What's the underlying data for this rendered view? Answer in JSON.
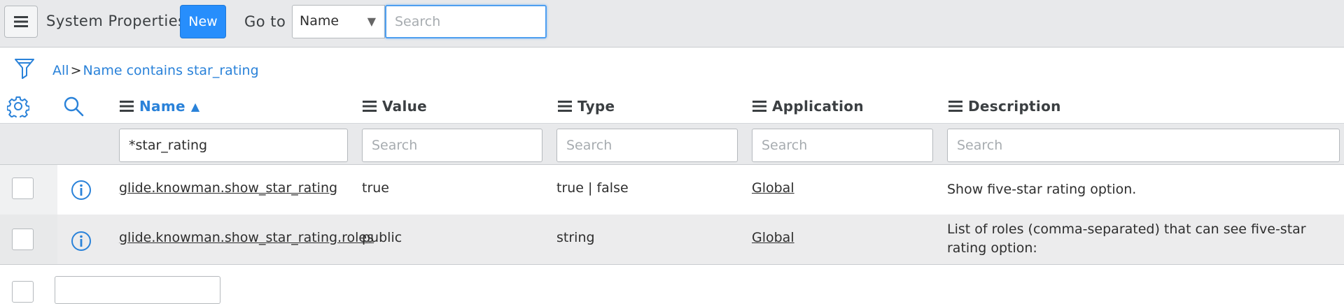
{
  "header": {
    "title": "System Properties",
    "new_label": "New",
    "goto_label": "Go to",
    "goto_field": "Name",
    "search_placeholder": "Search"
  },
  "breadcrumb": {
    "all": "All",
    "separator": ">",
    "condition": "Name contains star_rating"
  },
  "columns": [
    {
      "label": "Name",
      "sorted": "ascending"
    },
    {
      "label": "Value"
    },
    {
      "label": "Type"
    },
    {
      "label": "Application"
    },
    {
      "label": "Description"
    }
  ],
  "filters": {
    "name_value": "*star_rating",
    "placeholder": "Search"
  },
  "rows": [
    {
      "name": "glide.knowman.show_star_rating",
      "value": "true",
      "type": "true | false",
      "application": "Global",
      "description": "Show five-star rating option."
    },
    {
      "name": "glide.knowman.show_star_rating.roles",
      "value": "public",
      "type": "string",
      "application": "Global",
      "description": "List of roles (comma-separated) that can see five-star rating option:"
    }
  ],
  "icons": {
    "menu": "hamburger-icon",
    "filter": "funnel-icon",
    "settings": "gear-icon",
    "search": "magnifier-icon",
    "info": "info-circle-icon",
    "sort": "triangle-up-icon"
  },
  "colors": {
    "accent": "#278efc",
    "link": "#2a82d9",
    "header_bg": "#e8e9eb"
  }
}
